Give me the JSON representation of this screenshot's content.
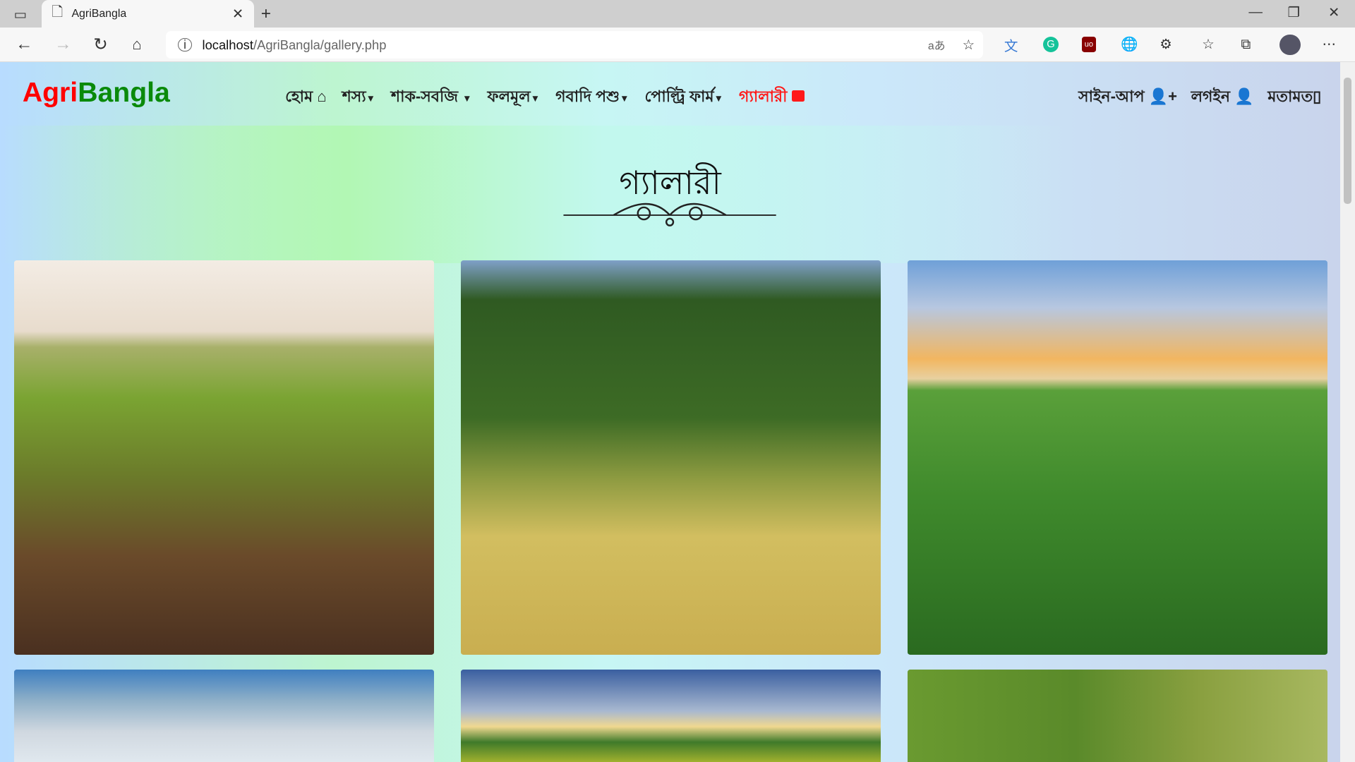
{
  "browser": {
    "tab_title": "AgriBangla",
    "url_host": "localhost",
    "url_path": "/AgriBangla/gallery.php",
    "translate_label": "aあ"
  },
  "site": {
    "logo_part1": "Agri",
    "logo_part2": "Bangla",
    "logo_colors": [
      "#ff0000",
      "#0a8a0a"
    ],
    "nav": [
      {
        "label": "হোম",
        "icon": "home-icon"
      },
      {
        "label": "শস্য",
        "dropdown": true
      },
      {
        "label": "শাক-সবজি",
        "dropdown": true
      },
      {
        "label": "ফলমূল",
        "dropdown": true
      },
      {
        "label": "গবাদি পশু",
        "dropdown": true
      },
      {
        "label": "পোল্ট্রি ফার্ম",
        "dropdown": true
      },
      {
        "label": "গ্যালারী",
        "icon": "camera-icon",
        "active": true,
        "color": "#ff1a1a"
      }
    ],
    "right_nav": [
      {
        "label": "সাইন-আপ",
        "icon": "user-plus-icon"
      },
      {
        "label": "লগইন",
        "icon": "user-icon"
      },
      {
        "label": "মতামত",
        "icon": "mobile-icon"
      }
    ]
  },
  "gallery": {
    "title": "গ্যালারী",
    "images": [
      "wheat-seedlings-field",
      "farmers-harvesting-straw",
      "corn-field-sunset",
      "sky-clouds-field",
      "green-hills-sunrise",
      "farmer-in-rice-field"
    ]
  }
}
